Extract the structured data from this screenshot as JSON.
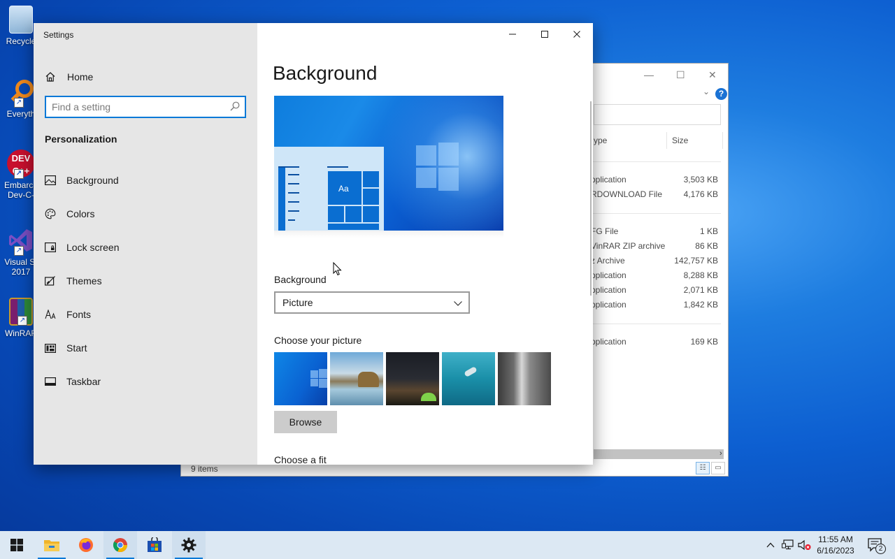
{
  "desktop": {
    "icons": [
      {
        "label": "Recycle"
      },
      {
        "label": "Everyth"
      },
      {
        "label": "Embarca",
        "label2": "Dev-C-"
      },
      {
        "label": "Visual St",
        "label2": "2017"
      },
      {
        "label": "WinRAR"
      }
    ]
  },
  "explorer": {
    "col_type": "ype",
    "col_size": "Size",
    "rows": [
      {
        "type": "pplication",
        "size": "3,503 KB"
      },
      {
        "type": "RDOWNLOAD File",
        "size": "4,176 KB"
      },
      {
        "type": "FG File",
        "size": "1 KB"
      },
      {
        "type": "VinRAR ZIP archive",
        "size": "86 KB"
      },
      {
        "type": "z Archive",
        "size": "142,757 KB"
      },
      {
        "type": "pplication",
        "size": "8,288 KB"
      },
      {
        "type": "pplication",
        "size": "2,071 KB"
      },
      {
        "type": "pplication",
        "size": "1,842 KB"
      },
      {
        "type": "pplication",
        "size": "169 KB"
      }
    ],
    "status": "9 items",
    "help": "?"
  },
  "settings": {
    "app_title": "Settings",
    "home_label": "Home",
    "search_placeholder": "Find a setting",
    "section": "Personalization",
    "nav_items": [
      {
        "label": "Background",
        "icon": "picture-icon"
      },
      {
        "label": "Colors",
        "icon": "palette-icon"
      },
      {
        "label": "Lock screen",
        "icon": "lock-screen-icon"
      },
      {
        "label": "Themes",
        "icon": "themes-icon"
      },
      {
        "label": "Fonts",
        "icon": "fonts-icon"
      },
      {
        "label": "Start",
        "icon": "start-icon"
      },
      {
        "label": "Taskbar",
        "icon": "taskbar-icon"
      }
    ],
    "page_title": "Background",
    "preview_text": "Aa",
    "background_label": "Background",
    "background_value": "Picture",
    "choose_picture_label": "Choose your picture",
    "browse_label": "Browse",
    "choose_fit_label": "Choose a fit",
    "accent_color": "#0078d7"
  },
  "taskbar": {
    "time": "11:55 AM",
    "date": "6/16/2023",
    "notification_count": "2"
  }
}
